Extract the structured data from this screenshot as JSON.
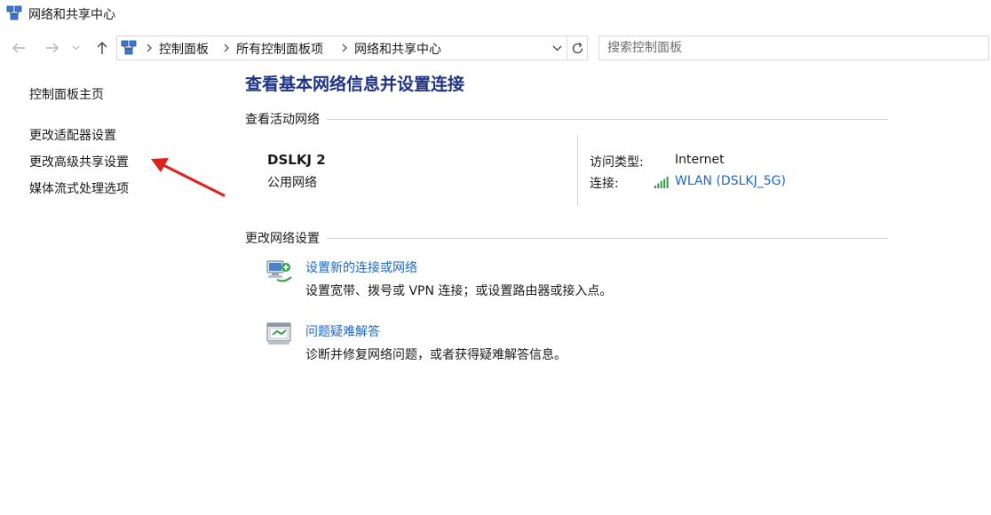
{
  "window": {
    "title": "网络和共享中心"
  },
  "navigation": {
    "breadcrumbs": [
      "控制面板",
      "所有控制面板项",
      "网络和共享中心"
    ],
    "search_placeholder": "搜索控制面板"
  },
  "sidebar": {
    "home": "控制面板主页",
    "items": [
      {
        "label": "更改适配器设置"
      },
      {
        "label": "更改高级共享设置"
      },
      {
        "label": "媒体流式处理选项"
      }
    ]
  },
  "main": {
    "title": "查看基本网络信息并设置连接",
    "active_networks": {
      "header": "查看活动网络",
      "network_name": "DSLKJ 2",
      "network_type": "公用网络",
      "access_type_label": "访问类型:",
      "access_type_value": "Internet",
      "connection_label": "连接:",
      "connection_value": "WLAN (DSLKJ_5G)"
    },
    "change_settings": {
      "header": "更改网络设置",
      "tasks": [
        {
          "title": "设置新的连接或网络",
          "description": "设置宽带、拨号或 VPN 连接；或设置路由器或接入点。",
          "icon": "new-connection-icon"
        },
        {
          "title": "问题疑难解答",
          "description": "诊断并修复网络问题，或者获得疑难解答信息。",
          "icon": "troubleshoot-icon"
        }
      ]
    }
  },
  "colors": {
    "link": "#1e66c8",
    "title": "#1e3287",
    "annotation_arrow": "#e0201b"
  }
}
